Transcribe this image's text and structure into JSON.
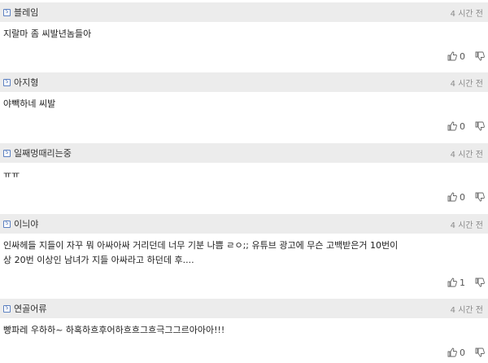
{
  "comments": [
    {
      "badge": "5",
      "username": "블레임",
      "time": "4 시간 전",
      "lines": [
        "지랄마 좀 씨발년놈들아"
      ],
      "likes": "0"
    },
    {
      "badge": "5",
      "username": "아지형",
      "time": "4 시간 전",
      "lines": [
        "야빽하네 씨발"
      ],
      "likes": "0"
    },
    {
      "badge": "5",
      "username": "일째멍때리는중",
      "time": "4 시간 전",
      "lines": [
        "ㅠㅠ"
      ],
      "likes": "0"
    },
    {
      "badge": "5",
      "username": "이늬야",
      "time": "4 시간 전",
      "lines": [
        "인싸헤들 지들이 자꾸 뭐 아싸아싸 거리던데 너무 기분 나쁨 ㄹㅇ;; 유튜브 광고에 무슨 고백받은거 10번이",
        "상 20번 이상인 남녀가 지들 아싸라고 하던데 후...."
      ],
      "likes": "1"
    },
    {
      "badge": "5",
      "username": "연골어류",
      "time": "4 시간 전",
      "lines": [
        "빵파레 우하하~ 하혹하흐후어하흐흐그흐극그그르아아아!!!"
      ],
      "likes": "0"
    }
  ],
  "colors": {
    "header_bg": "#ececec",
    "badge": "#3a64b0",
    "time": "#8a8a8a"
  },
  "icons": {
    "like": "thumbs-up-icon",
    "dislike": "thumbs-down-icon"
  }
}
